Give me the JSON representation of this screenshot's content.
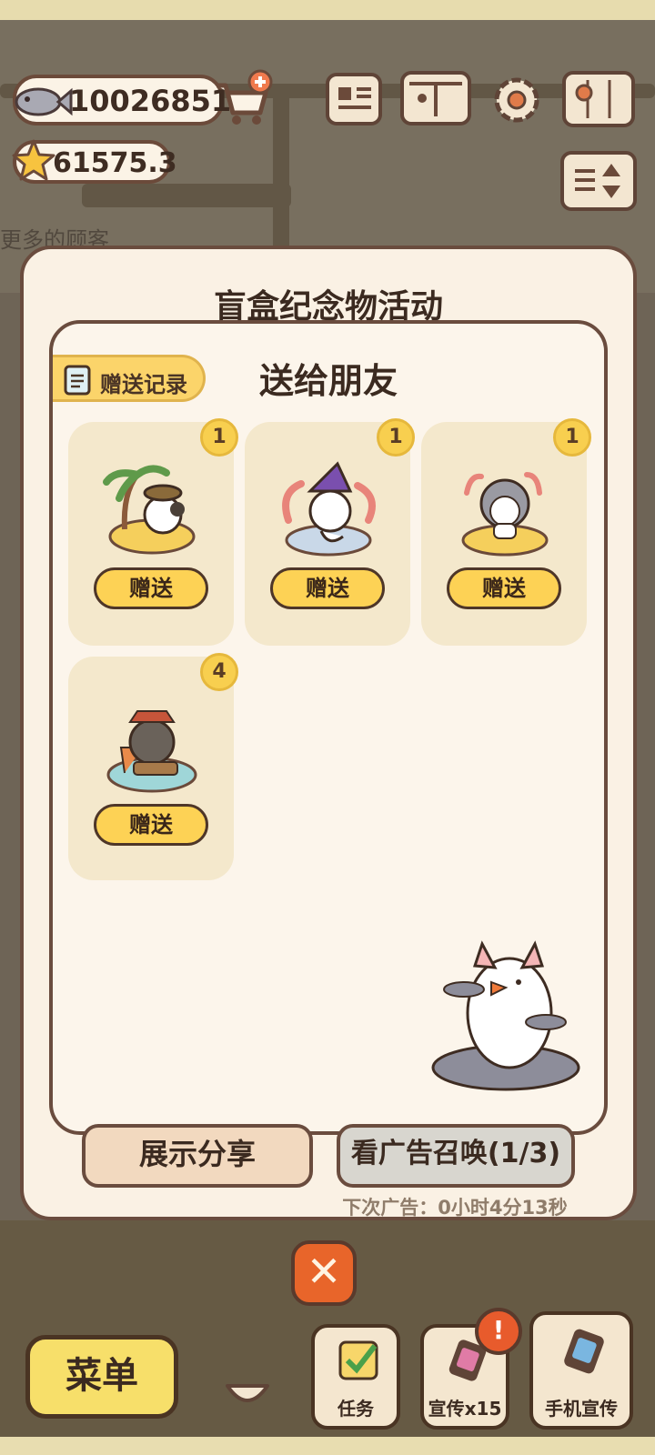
{
  "resources": {
    "fish": "10026851",
    "stars": "61575.3"
  },
  "background_text": "更多的顾客",
  "dialog": {
    "title": "盲盒纪念物活动",
    "inner_title": "送给朋友",
    "record_button": "赠送记录",
    "items": [
      {
        "count": "1",
        "button": "赠送",
        "icon": "souvenir-island-cat-icon"
      },
      {
        "count": "1",
        "button": "赠送",
        "icon": "souvenir-wizard-cat-icon"
      },
      {
        "count": "1",
        "button": "赠送",
        "icon": "souvenir-coral-cat-icon"
      },
      {
        "count": "4",
        "button": "赠送",
        "icon": "souvenir-pirate-cat-icon"
      }
    ],
    "share_button": "展示分享",
    "ad_button": "看广告召唤(1/3)",
    "next_ad": "下次广告：0小时4分13秒",
    "close_icon": "close-icon"
  },
  "bottom_bar": {
    "menu": "菜单",
    "tabs": [
      {
        "label": "任务",
        "icon": "checklist-icon"
      },
      {
        "label": "宣传x15",
        "icon": "phone-card-icon"
      },
      {
        "label": "手机宣传",
        "icon": "phone-card-icon"
      }
    ],
    "alert": "!"
  },
  "colors": {
    "accent_yellow": "#fdd255",
    "outline_brown": "#6a4c3e",
    "panel_cream": "#faf1e4",
    "close_orange": "#e8652a"
  }
}
